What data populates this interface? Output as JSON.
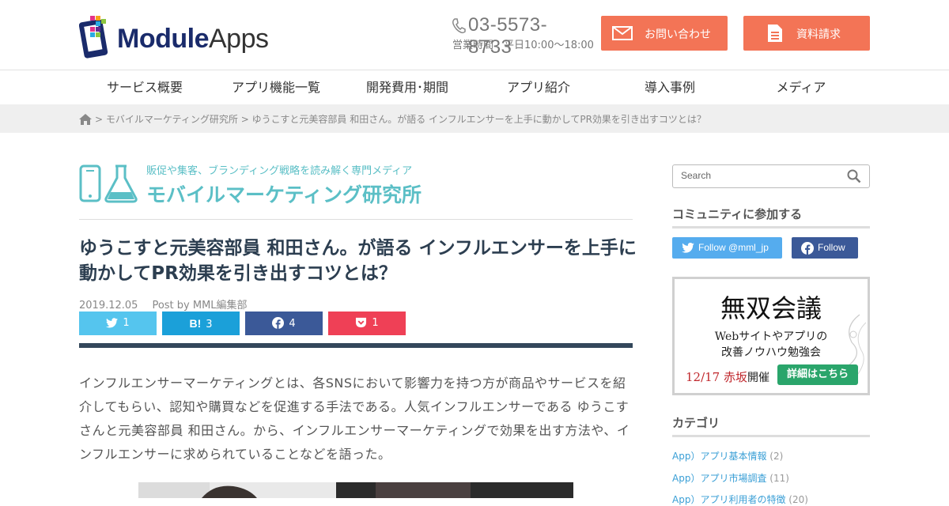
{
  "header": {
    "logo_bold": "Module",
    "logo_light": "Apps",
    "phone": "03-5573-8733",
    "hours": "営業時間　平日10:00〜18:00",
    "contact_button": "お問い合わせ",
    "document_button": "資料請求",
    "accent_color": "#f37456"
  },
  "nav": {
    "items": [
      "サービス概要",
      "アプリ機能一覧",
      "開発費用･期間",
      "アプリ紹介",
      "導入事例",
      "メディア"
    ]
  },
  "breadcrumb": {
    "sep": ">",
    "items": [
      "モバイルマーケティング研究所",
      "ゆうこすと元美容部員 和田さん。が語る インフルエンサーを上手に動かしてPR効果を引き出すコツとは？"
    ]
  },
  "media": {
    "tagline": "販促や集客、ブランディング戦略を読み解く専門メディア",
    "title": "モバイルマーケティング研究所",
    "color": "#5bbfc6"
  },
  "article": {
    "title": "ゆうこすと元美容部員 和田さん。が語る インフルエンサーを上手に動かしてPR効果を引き出すコツとは？",
    "date": "2019.12.05",
    "author": "Post by MML編集部",
    "share": {
      "twitter": "1",
      "hatena_icon": "B!",
      "hatena": "3",
      "facebook": "4",
      "pocket": "1"
    },
    "lead": "インフルエンサーマーケティングとは、各SNSにおいて影響力を持つ方が商品やサービスを紹介してもらい、認知や購買などを促進する手法である。人気インフルエンサーである ゆうこすさんと元美容部員 和田さん。から、インフルエンサーマーケティングで効果を出す方法や、インフルエンサーに求められていることなどを語った。"
  },
  "sidebar": {
    "search_placeholder": "Search",
    "community_heading": "コミュニティに参加する",
    "twitter_follow": "Follow @mml_jp",
    "facebook_follow": "Follow",
    "banner": {
      "title": "無双会議",
      "line1": "Webサイトやアプリの",
      "line2": "改善ノウハウ勉強会",
      "date": "12/17 赤坂",
      "held": "開催",
      "cta": "詳細はこちら"
    },
    "category_heading": "カテゴリ",
    "categories": [
      {
        "label": "App）アプリ基本情報",
        "count": "(2)"
      },
      {
        "label": "App）アプリ市場調査",
        "count": "(11)"
      },
      {
        "label": "App）アプリ利用者の特徴",
        "count": "(20)"
      }
    ]
  }
}
